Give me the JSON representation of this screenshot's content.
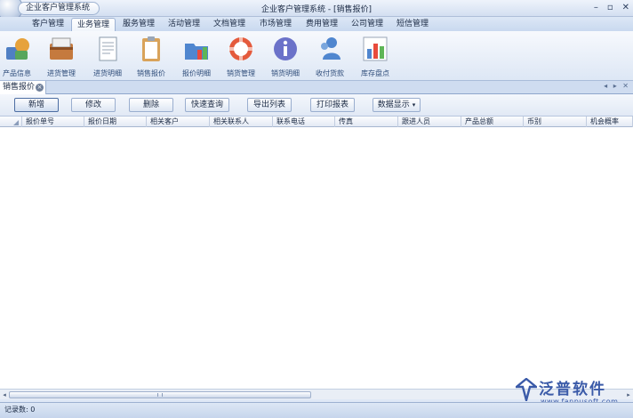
{
  "app": {
    "tab_label": "企业客户管理系统",
    "window_title": "企业客户管理系统 - [销售报价]",
    "controls": {
      "minimize": "–",
      "restore": "▫",
      "close": "✕"
    }
  },
  "menu_tabs": [
    {
      "label": "客户管理"
    },
    {
      "label": "业务管理",
      "active": true
    },
    {
      "label": "服务管理"
    },
    {
      "label": "活动管理"
    },
    {
      "label": "文档管理"
    },
    {
      "label": "市场管理"
    },
    {
      "label": "费用管理"
    },
    {
      "label": "公司管理"
    },
    {
      "label": "短信管理"
    }
  ],
  "ribbon": [
    {
      "label": "产品信息",
      "icon": "product-info-icon"
    },
    {
      "label": "进货管理",
      "icon": "purchase-manage-icon"
    },
    {
      "label": "进货明细",
      "icon": "purchase-detail-icon"
    },
    {
      "label": "销售报价",
      "icon": "sales-quote-icon"
    },
    {
      "label": "报价明细",
      "icon": "quote-detail-icon"
    },
    {
      "label": "销货管理",
      "icon": "sales-manage-icon"
    },
    {
      "label": "销货明细",
      "icon": "sales-detail-icon"
    },
    {
      "label": "收付货款",
      "icon": "payment-icon"
    },
    {
      "label": "库存盘点",
      "icon": "inventory-icon"
    }
  ],
  "doc_tab": {
    "label": "销售报价",
    "close": "×"
  },
  "strip_nav": "◂ ▸ ✕",
  "toolbar": {
    "add": "新增",
    "edit": "修改",
    "delete": "删除",
    "quick_search": "快速查询",
    "export": "导出列表",
    "print": "打印报表",
    "data_display": "数据显示",
    "dropdown_arrow": "▾"
  },
  "grid": {
    "columns": [
      "报价单号",
      "报价日期",
      "相关客户",
      "相关联系人",
      "联系电话",
      "传真",
      "跟进人员",
      "产品总额",
      "币别",
      "机会概率"
    ],
    "rows": []
  },
  "scrollbar": {
    "left": "◂",
    "right": "▸"
  },
  "watermark": {
    "text": "泛普软件",
    "url": "www.fanpusoft.com"
  },
  "status": {
    "record_count": "记录数: 0"
  }
}
